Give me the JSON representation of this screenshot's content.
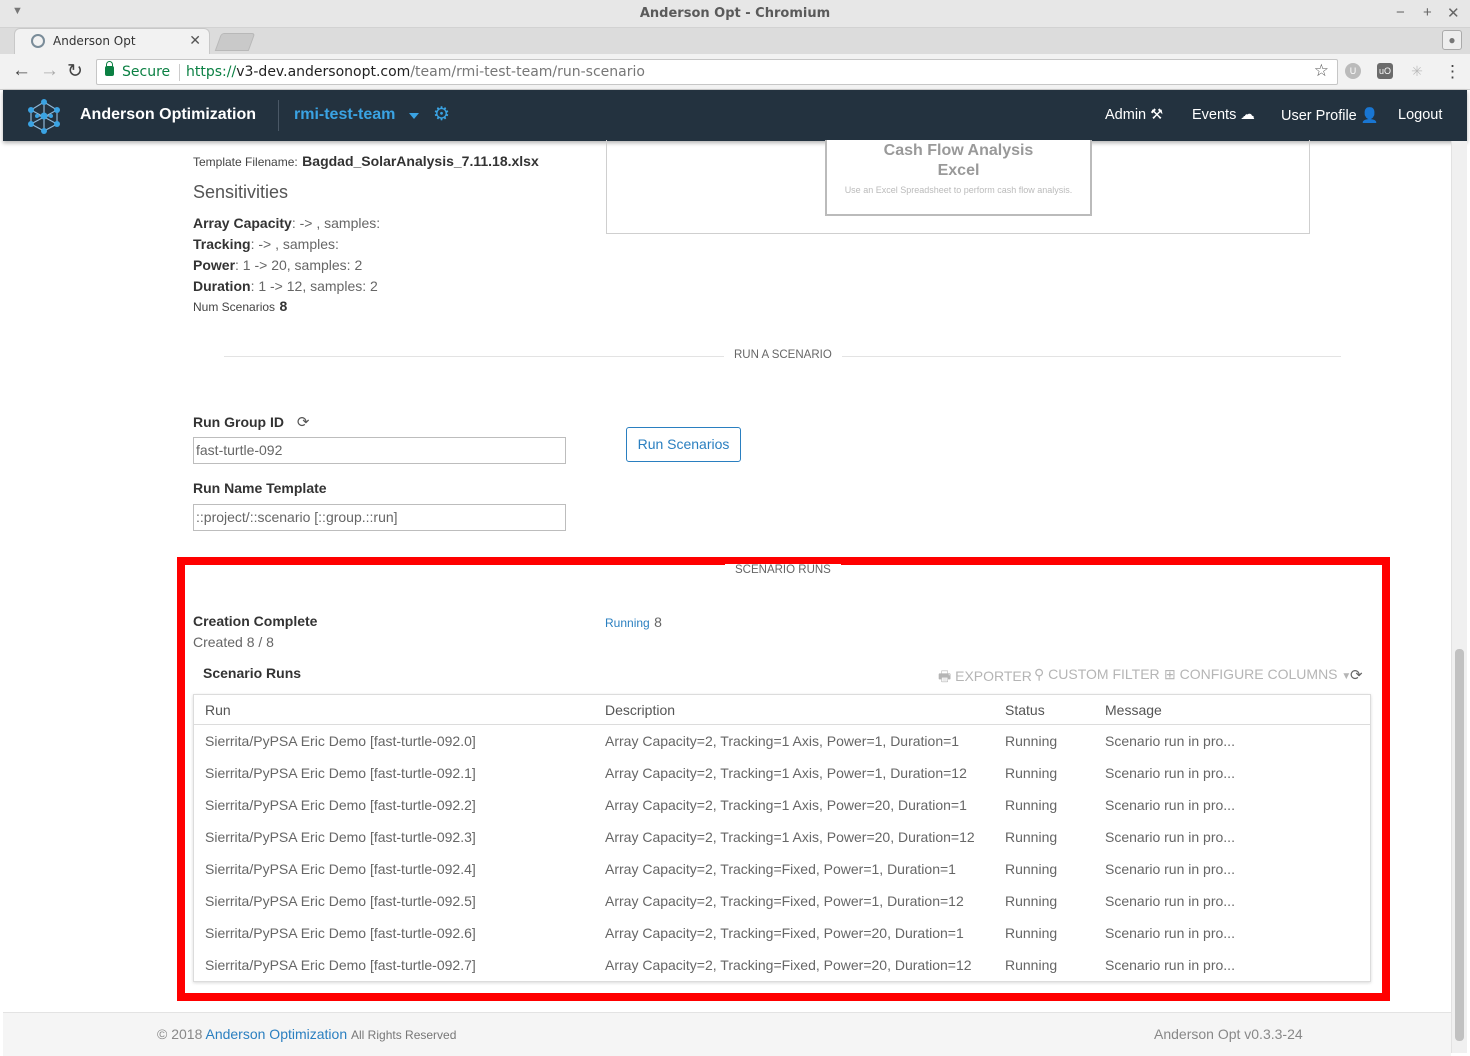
{
  "window": {
    "title": "Anderson Opt - Chromium",
    "tab_title": "Anderson Opt",
    "secure_label": "Secure",
    "url_scheme": "https://",
    "url_host": "v3-dev.andersonopt.com",
    "url_path": "/team/rmi-test-team/run-scenario"
  },
  "nav": {
    "brand": "Anderson Optimization",
    "team": "rmi-test-team",
    "links": {
      "admin": "Admin",
      "events": "Events",
      "profile": "User Profile",
      "logout": "Logout"
    }
  },
  "template": {
    "filename_label": "Template Filename:",
    "filename": "Bagdad_SolarAnalysis_7.11.18.xlsx"
  },
  "sensitivities": {
    "heading": "Sensitivities",
    "items": [
      {
        "name": "Array Capacity",
        "value": ": -> , samples:"
      },
      {
        "name": "Tracking",
        "value": ": -> , samples:"
      },
      {
        "name": "Power",
        "value": ": 1 -> 20, samples: 2"
      },
      {
        "name": "Duration",
        "value": ": 1 -> 12, samples: 2"
      }
    ],
    "num_label": "Num Scenarios",
    "num_value": "8"
  },
  "card": {
    "title_line1": "Cash Flow Analysis",
    "title_line2": "Excel",
    "description": "Use an Excel Spreadsheet to perform cash flow analysis."
  },
  "run_section": {
    "divider_label": "RUN A SCENARIO",
    "group_id_label": "Run Group ID",
    "group_id_value": "fast-turtle-092",
    "name_template_label": "Run Name Template",
    "name_template_value": "::project/::scenario [::group.::run]",
    "run_button": "Run Scenarios"
  },
  "scenario_runs": {
    "divider_label": "SCENARIO RUNS",
    "creation_status": "Creation Complete",
    "created_text": "Created 8 / 8",
    "running_label": "Running",
    "running_count": "8",
    "grid_title": "Scenario Runs",
    "tools": {
      "exporter": "EXPORTER",
      "custom_filter": "CUSTOM FILTER",
      "configure_columns": "CONFIGURE COLUMNS"
    },
    "columns": [
      "Run",
      "Description",
      "Status",
      "Message"
    ],
    "rows": [
      {
        "run": "Sierrita/PyPSA Eric Demo [fast-turtle-092.0]",
        "description": "Array Capacity=2, Tracking=1 Axis, Power=1, Duration=1",
        "status": "Running",
        "message": "Scenario run in pro..."
      },
      {
        "run": "Sierrita/PyPSA Eric Demo [fast-turtle-092.1]",
        "description": "Array Capacity=2, Tracking=1 Axis, Power=1, Duration=12",
        "status": "Running",
        "message": "Scenario run in pro..."
      },
      {
        "run": "Sierrita/PyPSA Eric Demo [fast-turtle-092.2]",
        "description": "Array Capacity=2, Tracking=1 Axis, Power=20, Duration=1",
        "status": "Running",
        "message": "Scenario run in pro..."
      },
      {
        "run": "Sierrita/PyPSA Eric Demo [fast-turtle-092.3]",
        "description": "Array Capacity=2, Tracking=1 Axis, Power=20, Duration=12",
        "status": "Running",
        "message": "Scenario run in pro..."
      },
      {
        "run": "Sierrita/PyPSA Eric Demo [fast-turtle-092.4]",
        "description": "Array Capacity=2, Tracking=Fixed, Power=1, Duration=1",
        "status": "Running",
        "message": "Scenario run in pro..."
      },
      {
        "run": "Sierrita/PyPSA Eric Demo [fast-turtle-092.5]",
        "description": "Array Capacity=2, Tracking=Fixed, Power=1, Duration=12",
        "status": "Running",
        "message": "Scenario run in pro..."
      },
      {
        "run": "Sierrita/PyPSA Eric Demo [fast-turtle-092.6]",
        "description": "Array Capacity=2, Tracking=Fixed, Power=20, Duration=1",
        "status": "Running",
        "message": "Scenario run in pro..."
      },
      {
        "run": "Sierrita/PyPSA Eric Demo [fast-turtle-092.7]",
        "description": "Array Capacity=2, Tracking=Fixed, Power=20, Duration=12",
        "status": "Running",
        "message": "Scenario run in pro..."
      }
    ]
  },
  "footer": {
    "copyright": "© 2018",
    "company": "Anderson Optimization",
    "rights": "All Rights Reserved",
    "version": "Anderson Opt v0.3.3-24"
  },
  "colors": {
    "nav_bg": "#23323f",
    "accent": "#3aa3e3",
    "link": "#2a7fc0",
    "highlight": "#ff0000"
  },
  "icons": {
    "refresh": "refresh-icon",
    "gear": "gear-icon",
    "tools": "tools-icon",
    "cloud": "cloud-icon",
    "user": "user-icon"
  }
}
